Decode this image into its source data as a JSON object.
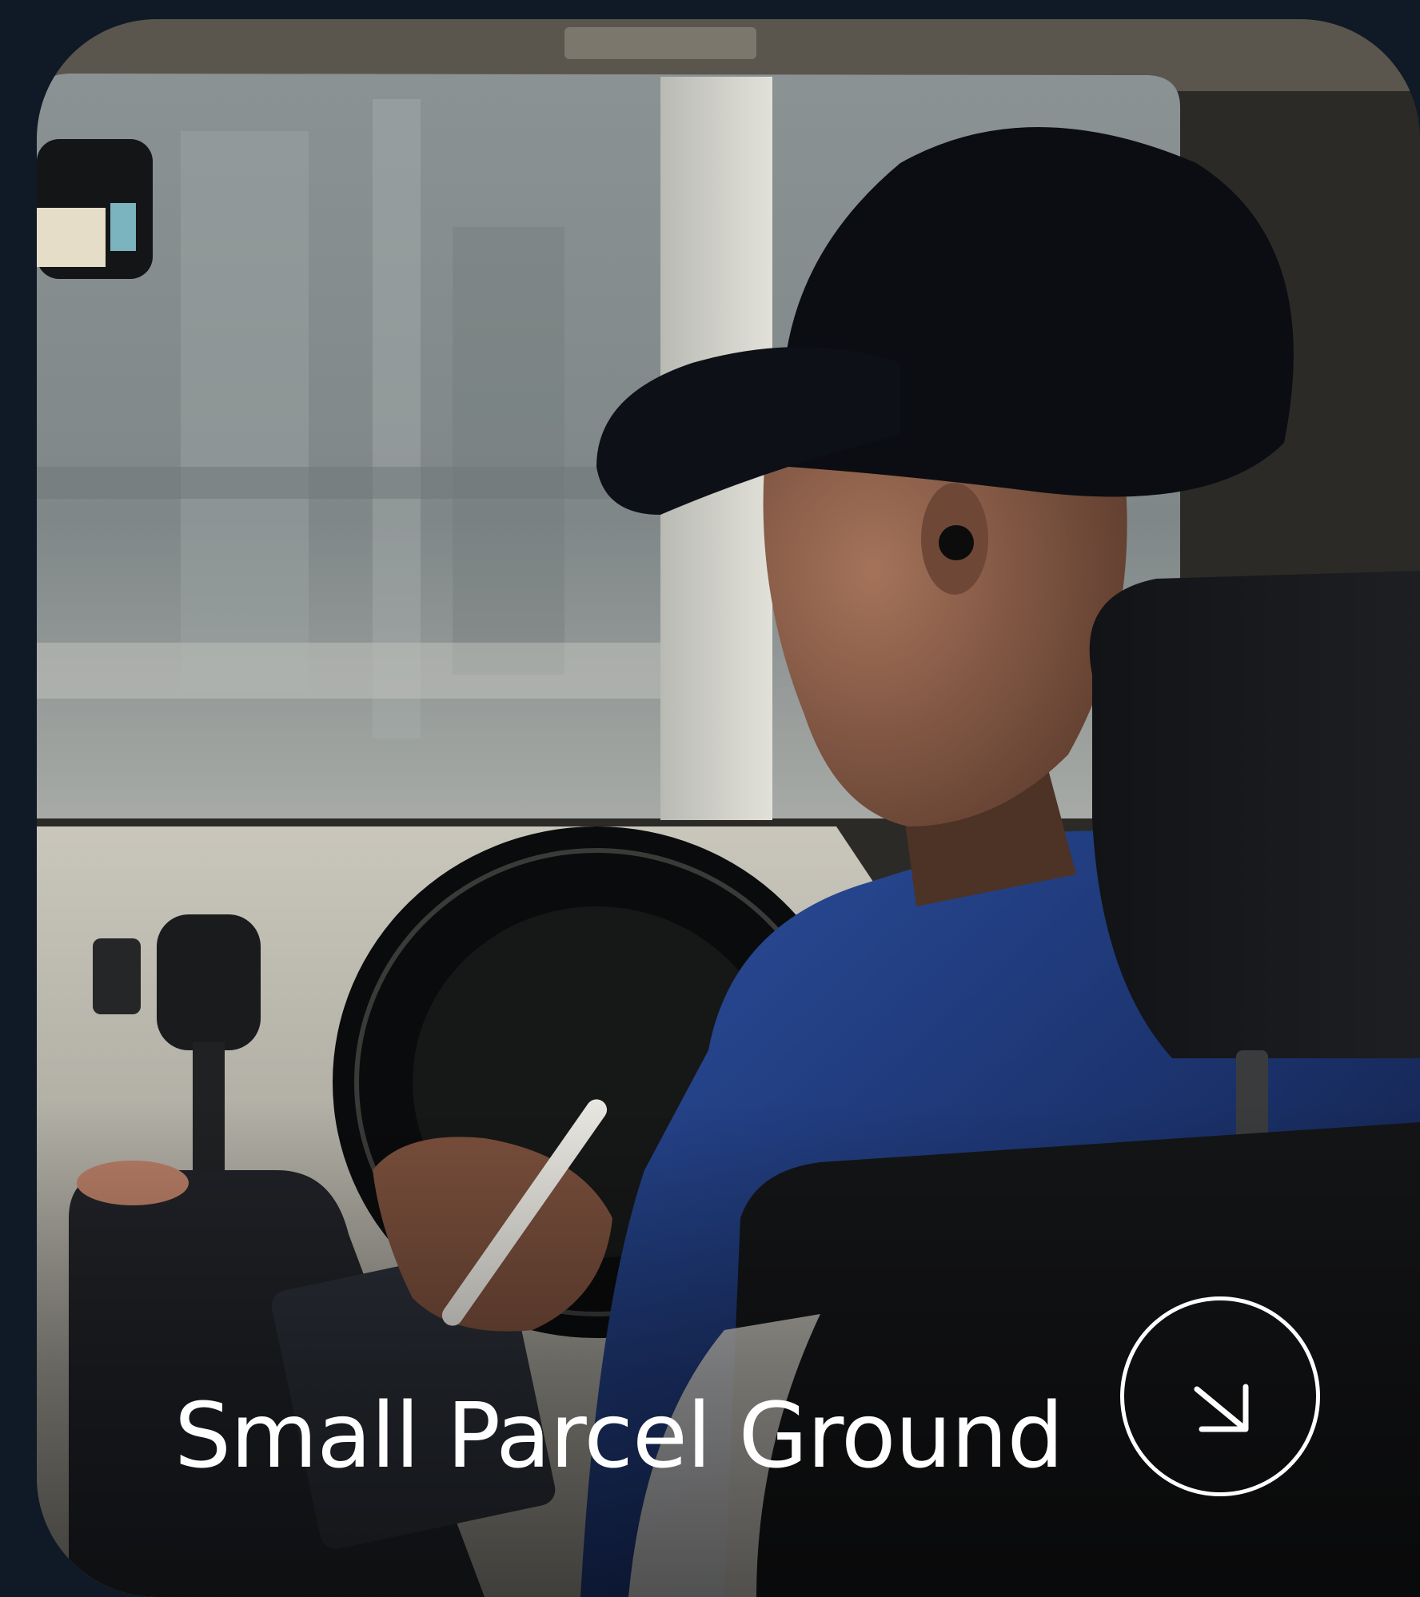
{
  "page": {
    "background_color": "#0f1a26"
  },
  "service_card": {
    "title": "Small Parcel Ground",
    "photo_subject": "delivery driver in cap and blue shirt writing on a clipboard inside a van cab",
    "action_icon": "arrow-down-right-icon",
    "title_color": "#ffffff"
  }
}
